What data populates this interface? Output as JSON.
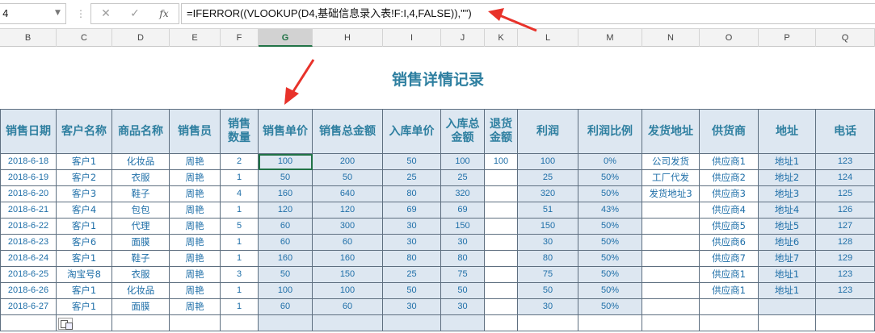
{
  "formula_bar": {
    "name_box": "4",
    "cancel_glyph": "✕",
    "enter_glyph": "✓",
    "fx_label": "fx",
    "formula": "=IFERROR((VLOOKUP(D4,基础信息录入表!F:I,4,FALSE)),\"\")"
  },
  "columns": [
    "B",
    "C",
    "D",
    "E",
    "F",
    "G",
    "H",
    "I",
    "J",
    "K",
    "L",
    "M",
    "N",
    "O",
    "P",
    "Q"
  ],
  "selected_column": "G",
  "sheet": {
    "title": "销售详情记录",
    "headers": [
      "销售日期",
      "客户名称",
      "商品名称",
      "销售员",
      "销售\n数量",
      "销售单价",
      "销售总金额",
      "入库单价",
      "入库总\n金额",
      "退货\n金额",
      "利润",
      "利润比例",
      "发货地址",
      "供货商",
      "地址",
      "电话"
    ],
    "rows": [
      [
        "2018-6-18",
        "客户1",
        "化妆品",
        "周艳",
        "2",
        "100",
        "200",
        "50",
        "100",
        "100",
        "100",
        "0%",
        "公司发货",
        "供应商1",
        "地址1",
        "123"
      ],
      [
        "2018-6-19",
        "客户2",
        "衣服",
        "周艳",
        "1",
        "50",
        "50",
        "25",
        "25",
        "",
        "25",
        "50%",
        "工厂代发",
        "供应商2",
        "地址2",
        "124"
      ],
      [
        "2018-6-20",
        "客户3",
        "鞋子",
        "周艳",
        "4",
        "160",
        "640",
        "80",
        "320",
        "",
        "320",
        "50%",
        "发货地址3",
        "供应商3",
        "地址3",
        "125"
      ],
      [
        "2018-6-21",
        "客户4",
        "包包",
        "周艳",
        "1",
        "120",
        "120",
        "69",
        "69",
        "",
        "51",
        "43%",
        "",
        "供应商4",
        "地址4",
        "126"
      ],
      [
        "2018-6-22",
        "客户1",
        "代理",
        "周艳",
        "5",
        "60",
        "300",
        "30",
        "150",
        "",
        "150",
        "50%",
        "",
        "供应商5",
        "地址5",
        "127"
      ],
      [
        "2018-6-23",
        "客户6",
        "面膜",
        "周艳",
        "1",
        "60",
        "60",
        "30",
        "30",
        "",
        "30",
        "50%",
        "",
        "供应商6",
        "地址6",
        "128"
      ],
      [
        "2018-6-24",
        "客户1",
        "鞋子",
        "周艳",
        "1",
        "160",
        "160",
        "80",
        "80",
        "",
        "80",
        "50%",
        "",
        "供应商7",
        "地址7",
        "129"
      ],
      [
        "2018-6-25",
        "淘宝号8",
        "衣服",
        "周艳",
        "3",
        "50",
        "150",
        "25",
        "75",
        "",
        "75",
        "50%",
        "",
        "供应商1",
        "地址1",
        "123"
      ],
      [
        "2018-6-26",
        "客户1",
        "化妆品",
        "周艳",
        "1",
        "100",
        "100",
        "50",
        "50",
        "",
        "50",
        "50%",
        "",
        "供应商1",
        "地址1",
        "123"
      ],
      [
        "2018-6-27",
        "客户1",
        "面膜",
        "周艳",
        "1",
        "60",
        "60",
        "30",
        "30",
        "",
        "30",
        "50%",
        "",
        "",
        "",
        ""
      ],
      [
        "",
        "",
        "",
        "",
        "",
        "",
        "",
        "",
        "",
        "",
        "",
        "",
        "",
        "",
        "",
        ""
      ]
    ]
  },
  "colors": {
    "header_fill": "#dde7f1",
    "title_color": "#2e7fa0",
    "cell_text": "#1f6fa8",
    "selection": "#217346",
    "annotation_arrow": "#e8322a"
  },
  "icons": [
    "paste-options-icon",
    "annotation-arrow"
  ]
}
